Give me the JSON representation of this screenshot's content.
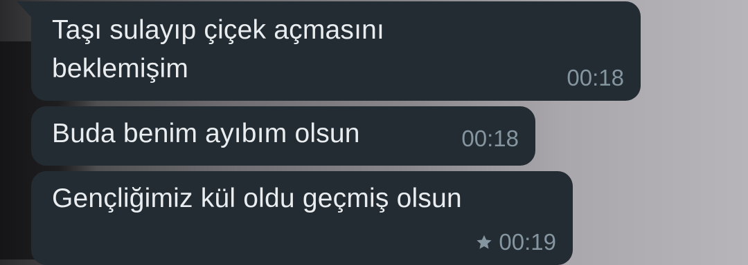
{
  "messages": [
    {
      "text": "Taşı sulayıp çiçek açmasını\nbeklemişim",
      "time": "00:18",
      "starred": false
    },
    {
      "text": "Buda benim ayıbım olsun",
      "time": "00:18",
      "starred": false
    },
    {
      "text": "Gençliğimiz kül oldu geçmiş olsun",
      "time": "00:19",
      "starred": true
    }
  ],
  "colors": {
    "bubble_background": "#232c33",
    "message_text": "#e9edef",
    "timestamp": "#8696a0"
  },
  "icons": {
    "starred": "star-icon"
  }
}
